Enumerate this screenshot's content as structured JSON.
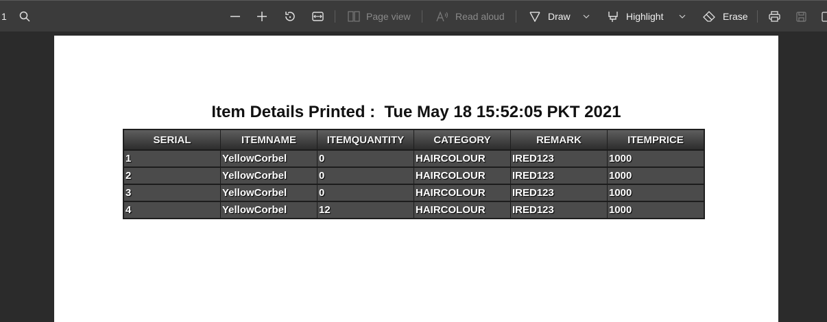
{
  "toolbar": {
    "page_number": "1",
    "page_view_label": "Page view",
    "read_aloud_label": "Read aloud",
    "draw_label": "Draw",
    "highlight_label": "Highlight",
    "erase_label": "Erase",
    "icons": [
      "search-icon",
      "zoom-out-icon",
      "zoom-in-icon",
      "rotate-icon",
      "fit-width-icon",
      "page-view-icon",
      "read-aloud-icon",
      "draw-icon",
      "chevron-down-icon",
      "highlight-icon",
      "chevron-down-icon",
      "eraser-icon",
      "print-icon",
      "save-icon",
      "save-as-icon"
    ]
  },
  "document": {
    "title": "Item Details Printed :  Tue May 18 15:52:05 PKT 2021",
    "table": {
      "headers": [
        "SERIAL",
        "ITEMNAME",
        "ITEMQUANTITY",
        "CATEGORY",
        "REMARK",
        "ITEMPRICE"
      ],
      "rows": [
        [
          "1",
          "YellowCorbel",
          "0",
          "HAIRCOLOUR",
          "IRED123",
          "1000"
        ],
        [
          "2",
          "YellowCorbel",
          "0",
          "HAIRCOLOUR",
          "IRED123",
          "1000"
        ],
        [
          "3",
          "YellowCorbel",
          "0",
          "HAIRCOLOUR",
          "IRED123",
          "1000"
        ],
        [
          "4",
          "YellowCorbel",
          "12",
          "HAIRCOLOUR",
          "IRED123",
          "1000"
        ]
      ]
    }
  },
  "colors": {
    "toolbar_bg": "#3b3b3b",
    "viewer_bg": "#2b2b2b",
    "page_bg": "#ffffff",
    "table_header_bg": "#3a3a3a",
    "table_cell_bg": "#4b4b4b"
  }
}
